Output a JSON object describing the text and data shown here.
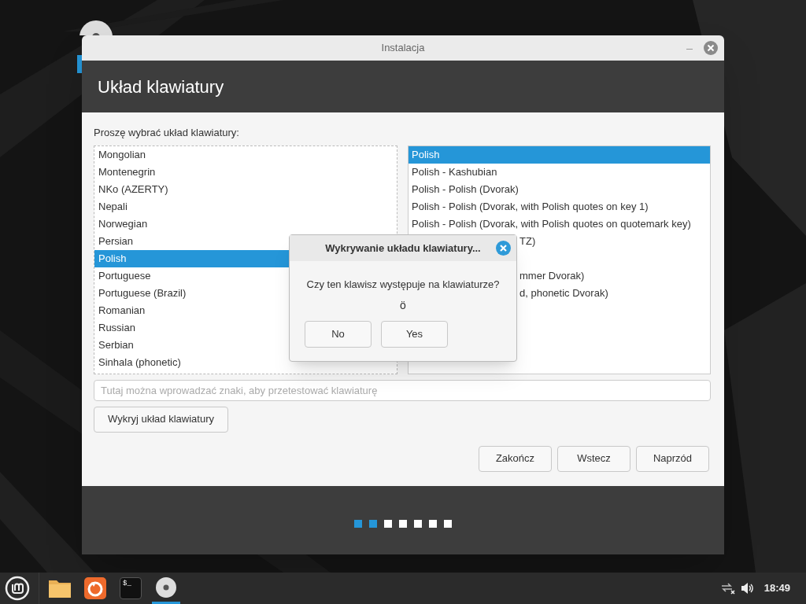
{
  "window": {
    "title": "Instalacja",
    "heading": "Układ klawiatury"
  },
  "prompt": "Proszę wybrać układ klawiatury:",
  "layouts": [
    {
      "label": "Mongolian",
      "selected": false
    },
    {
      "label": "Montenegrin",
      "selected": false
    },
    {
      "label": "NKo (AZERTY)",
      "selected": false
    },
    {
      "label": "Nepali",
      "selected": false
    },
    {
      "label": "Norwegian",
      "selected": false
    },
    {
      "label": "Persian",
      "selected": false
    },
    {
      "label": "Polish",
      "selected": true
    },
    {
      "label": "Portuguese",
      "selected": false
    },
    {
      "label": "Portuguese (Brazil)",
      "selected": false
    },
    {
      "label": "Romanian",
      "selected": false
    },
    {
      "label": "Russian",
      "selected": false
    },
    {
      "label": "Serbian",
      "selected": false
    },
    {
      "label": "Sinhala (phonetic)",
      "selected": false
    }
  ],
  "variants": [
    {
      "label": "Polish",
      "selected": true,
      "partial": false
    },
    {
      "label": "Polish - Kashubian",
      "selected": false,
      "partial": false
    },
    {
      "label": "Polish - Polish (Dvorak)",
      "selected": false,
      "partial": false
    },
    {
      "label": "Polish - Polish (Dvorak, with Polish quotes on key 1)",
      "selected": false,
      "partial": false
    },
    {
      "label": "Polish - Polish (Dvorak, with Polish quotes on quotemark key)",
      "selected": false,
      "partial": false
    },
    {
      "label": "TZ)",
      "selected": false,
      "partial": true
    },
    {
      "label": "mmer Dvorak)",
      "selected": false,
      "partial": true
    },
    {
      "label": "d, phonetic Dvorak)",
      "selected": false,
      "partial": true
    }
  ],
  "test_field": {
    "placeholder": "Tutaj można wprowadzać znaki, aby przetestować klawiaturę"
  },
  "detect_button": "Wykryj układ klawiatury",
  "buttons": [
    "Zakończ",
    "Wstecz",
    "Naprzód"
  ],
  "steps": [
    {
      "done": true
    },
    {
      "done": true
    },
    {
      "done": false
    },
    {
      "done": false
    },
    {
      "done": false
    },
    {
      "done": false
    },
    {
      "done": false
    }
  ],
  "dialog": {
    "title": "Wykrywanie układu klawiatury...",
    "question": "Czy ten klawisz występuje na klawiaturze?",
    "key": "ö",
    "buttons": [
      "No",
      "Yes"
    ]
  },
  "taskbar": {
    "apps": [
      {
        "kind": "folder",
        "active": false
      },
      {
        "kind": "browser",
        "active": false
      },
      {
        "kind": "terminal",
        "label": "$_",
        "active": false
      },
      {
        "kind": "disc",
        "active": true
      }
    ],
    "clock": "18:49"
  }
}
